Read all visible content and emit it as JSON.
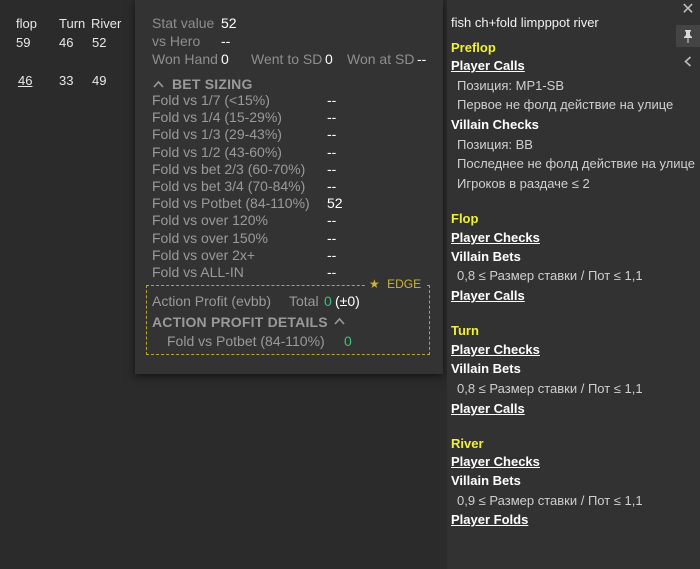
{
  "mini_table": {
    "headers": [
      "flop",
      "Turn",
      "River"
    ],
    "row1": [
      "59",
      "46",
      "52"
    ],
    "row2": [
      "46",
      "33",
      "49"
    ]
  },
  "stat": {
    "stat_value_label": "Stat value",
    "stat_value": "52",
    "vs_hero_label": "vs Hero",
    "vs_hero": "--",
    "won_hand_label": "Won Hand",
    "won_hand": "0",
    "went_sd_label": "Went to SD",
    "went_sd": "0",
    "won_sd_label": "Won at SD",
    "won_sd": "--"
  },
  "bet_sizing": {
    "title": "BET SIZING",
    "rows": [
      {
        "label": "Fold vs 1/7 (<15%)",
        "value": "--"
      },
      {
        "label": "Fold vs 1/4 (15-29%)",
        "value": "--"
      },
      {
        "label": "Fold vs 1/3 (29-43%)",
        "value": "--"
      },
      {
        "label": "Fold vs 1/2 (43-60%)",
        "value": "--"
      },
      {
        "label": "Fold vs bet 2/3 (60-70%)",
        "value": "--"
      },
      {
        "label": "Fold vs bet 3/4 (70-84%)",
        "value": "--"
      },
      {
        "label": "Fold vs Potbet (84-110%)",
        "value": "52"
      },
      {
        "label": "Fold vs over 120%",
        "value": "--"
      },
      {
        "label": "Fold vs over 150%",
        "value": "--"
      },
      {
        "label": "Fold vs over 2x+",
        "value": "--"
      },
      {
        "label": "Fold vs ALL-IN",
        "value": "--"
      }
    ]
  },
  "edge": {
    "legend": "EDGE",
    "action_profit_label": "Action Profit (evbb)",
    "total_label": "Total",
    "total_value": "0",
    "total_delta": "(±0)",
    "details_title": "ACTION PROFIT DETAILS",
    "detail_label": "Fold vs Potbet (84-110%)",
    "detail_value": "0"
  },
  "panel": {
    "title": "fish ch+fold limpppot river",
    "preflop": {
      "street": "Preflop",
      "player_action": "Player Calls",
      "cond1": "Позиция: MP1-SB",
      "cond2": "Первое не фолд действие на улице",
      "villain_action": "Villain Checks",
      "cond3": "Позиция: BB",
      "cond4": "Последнее не фолд действие на улице",
      "cond5": "Игроков в раздаче ≤ 2"
    },
    "flop": {
      "street": "Flop",
      "player_action": "Player Checks",
      "villain_action": "Villain Bets",
      "cond1": "0,8 ≤ Размер ставки / Пот ≤ 1,1",
      "player_action2": "Player Calls"
    },
    "turn": {
      "street": "Turn",
      "player_action": "Player Checks",
      "villain_action": "Villain Bets",
      "cond1": "0,8 ≤ Размер ставки / Пот ≤ 1,1",
      "player_action2": "Player Calls"
    },
    "river": {
      "street": "River",
      "player_action": "Player Checks",
      "villain_action": "Villain Bets",
      "cond1": "0,9 ≤ Размер ставки / Пот ≤ 1,1",
      "player_action2": "Player Folds"
    }
  },
  "colors": {
    "street": "#f0f03a",
    "green": "#39c27a",
    "edge": "#c9b43a"
  },
  "icons": [
    "close-icon",
    "pin-icon",
    "chevron-left-icon",
    "chevron-up-icon",
    "star-icon"
  ]
}
